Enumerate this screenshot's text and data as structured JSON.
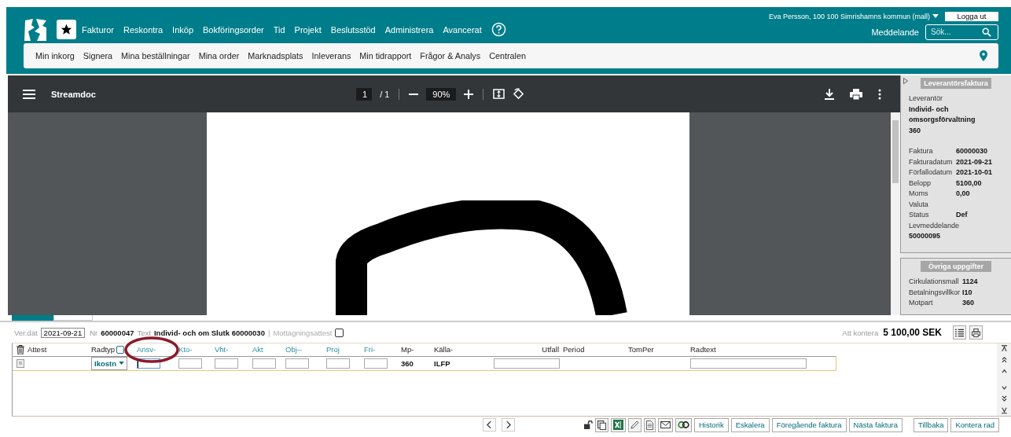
{
  "header": {
    "user": "Eva Persson, 100 100 Simrishamns kommun (mall)",
    "logout": "Logga ut",
    "nav": [
      "Fakturor",
      "Reskontra",
      "Inköp",
      "Bokföringsorder",
      "Tid",
      "Projekt",
      "Beslutsstöd",
      "Administrera",
      "Avancerat"
    ],
    "messages": "Meddelande",
    "search": {
      "placeholder": "Sök..."
    }
  },
  "subnav": [
    "Min inkorg",
    "Signera",
    "Mina beställningar",
    "Mina order",
    "Marknadsplats",
    "Inleverans",
    "Min tidrapport",
    "Frågor & Analys",
    "Centralen"
  ],
  "viewer": {
    "title": "Streamdoc",
    "page": "1",
    "page_count": "/ 1",
    "zoom": "90%"
  },
  "supplier_panel": {
    "heading": "Leverantörsfaktura",
    "label": "Leverantör",
    "name": "Individ- och omsorgsförvaltning",
    "code": "360",
    "fields": [
      {
        "label": "Faktura",
        "value": "60000030"
      },
      {
        "label": "Fakturadatum",
        "value": "2021-09-21"
      },
      {
        "label": "Förfallodatum",
        "value": "2021-10-01"
      },
      {
        "label": "Belopp",
        "value": "5100,00"
      },
      {
        "label": "Moms",
        "value": "0,00"
      },
      {
        "label": "Valuta"
      },
      {
        "label": "Status",
        "value": "Def"
      }
    ],
    "message_label": "Levmeddelande",
    "message": "50000095"
  },
  "other_panel": {
    "heading": "Övriga uppgifter",
    "fields": [
      {
        "label": "Cirkulationsmall",
        "value": "1124"
      },
      {
        "label": "Betalningsvillkor",
        "value": "I10"
      },
      {
        "label": "Motpart",
        "value": "360"
      }
    ]
  },
  "tabs": [
    {
      "selected": true
    },
    {
      "selected": false
    }
  ],
  "voucher": {
    "date_label": "Ver.dat",
    "date": "2021-09-21",
    "nr_label": "Nr",
    "nr": "60000047",
    "text_label": "Text",
    "text": "Individ- och om Slutk 60000030",
    "separator": "|",
    "receipt_label": "Mottagningsattest",
    "receipt_checked": false,
    "total_label": "Att kontera",
    "total": "5 100,00 SEK"
  },
  "grid": {
    "columns": [
      {
        "label": "Attest",
        "kind": "trash"
      },
      {
        "label": "Radtyp",
        "kind": "check",
        "checked": false
      },
      {
        "label": "Ansv-",
        "kind": "link"
      },
      {
        "label": "Kto-",
        "kind": "link"
      },
      {
        "label": "Vht-",
        "kind": "link"
      },
      {
        "label": "Akt",
        "kind": "link"
      },
      {
        "label": "Obj--",
        "kind": "link"
      },
      {
        "label": "Proj",
        "kind": "link"
      },
      {
        "label": "Fri-",
        "kind": "link"
      },
      {
        "label": "Mp-",
        "kind": "plain"
      },
      {
        "label": "Källa-",
        "kind": "plain"
      },
      {
        "label": "Utfall",
        "kind": "right"
      },
      {
        "label": "Period",
        "kind": "plain"
      },
      {
        "label": "TomPer",
        "kind": "plain"
      },
      {
        "label": "Radtext",
        "kind": "plain"
      }
    ],
    "row": [
      {
        "kind": "icon"
      },
      {
        "kind": "select",
        "value": "Ikostn"
      },
      {
        "kind": "input",
        "focused": true
      },
      {
        "kind": "input",
        "focused": false
      },
      {
        "kind": "input",
        "focused": false
      },
      {
        "kind": "input",
        "focused": false
      },
      {
        "kind": "input",
        "focused": false
      },
      {
        "kind": "input",
        "focused": false
      },
      {
        "kind": "input",
        "focused": false
      },
      {
        "kind": "text",
        "value": "360"
      },
      {
        "kind": "text",
        "value": "ILFP"
      },
      {
        "kind": "wide",
        "focused": false
      },
      {
        "kind": "empty"
      },
      {
        "kind": "empty"
      },
      {
        "kind": "wide",
        "focused": false
      }
    ]
  },
  "actions": [
    "Historik",
    "Eskalera",
    "Föregående faktura",
    "Nästa faktura"
  ],
  "final_actions": [
    "Tillbaka",
    "Kontera rad"
  ]
}
